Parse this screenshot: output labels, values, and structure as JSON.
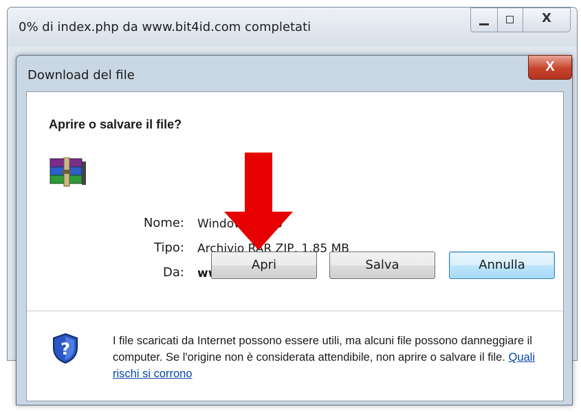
{
  "background_window": {
    "title": "0% di index.php da www.bit4id.com completati",
    "close_symbol": "X"
  },
  "dialog": {
    "title": "Download del file",
    "close_symbol": "X",
    "question": "Aprire o salvare il file?",
    "file_icon": "winrar-archive-icon",
    "fields": {
      "name_label": "Nome:",
      "name_value": "Window        up.zip",
      "type_label": "Tipo:",
      "type_value": "Archivio      RAR ZIP, 1,85 MB",
      "from_label": "Da:",
      "from_value": "www.bi        .com"
    },
    "buttons": {
      "open": "Apri",
      "save": "Salva",
      "cancel": "Annulla"
    },
    "warning": {
      "icon": "security-shield-question-icon",
      "text": "I file scaricati da Internet possono essere utili, ma alcuni file possono danneggiare il computer. Se l'origine non è considerata attendibile, non aprire o salvare il file.",
      "link": "Quali rischi si corrono"
    }
  },
  "annotation": {
    "icon": "red-arrow-down-icon",
    "color": "#e60000"
  }
}
